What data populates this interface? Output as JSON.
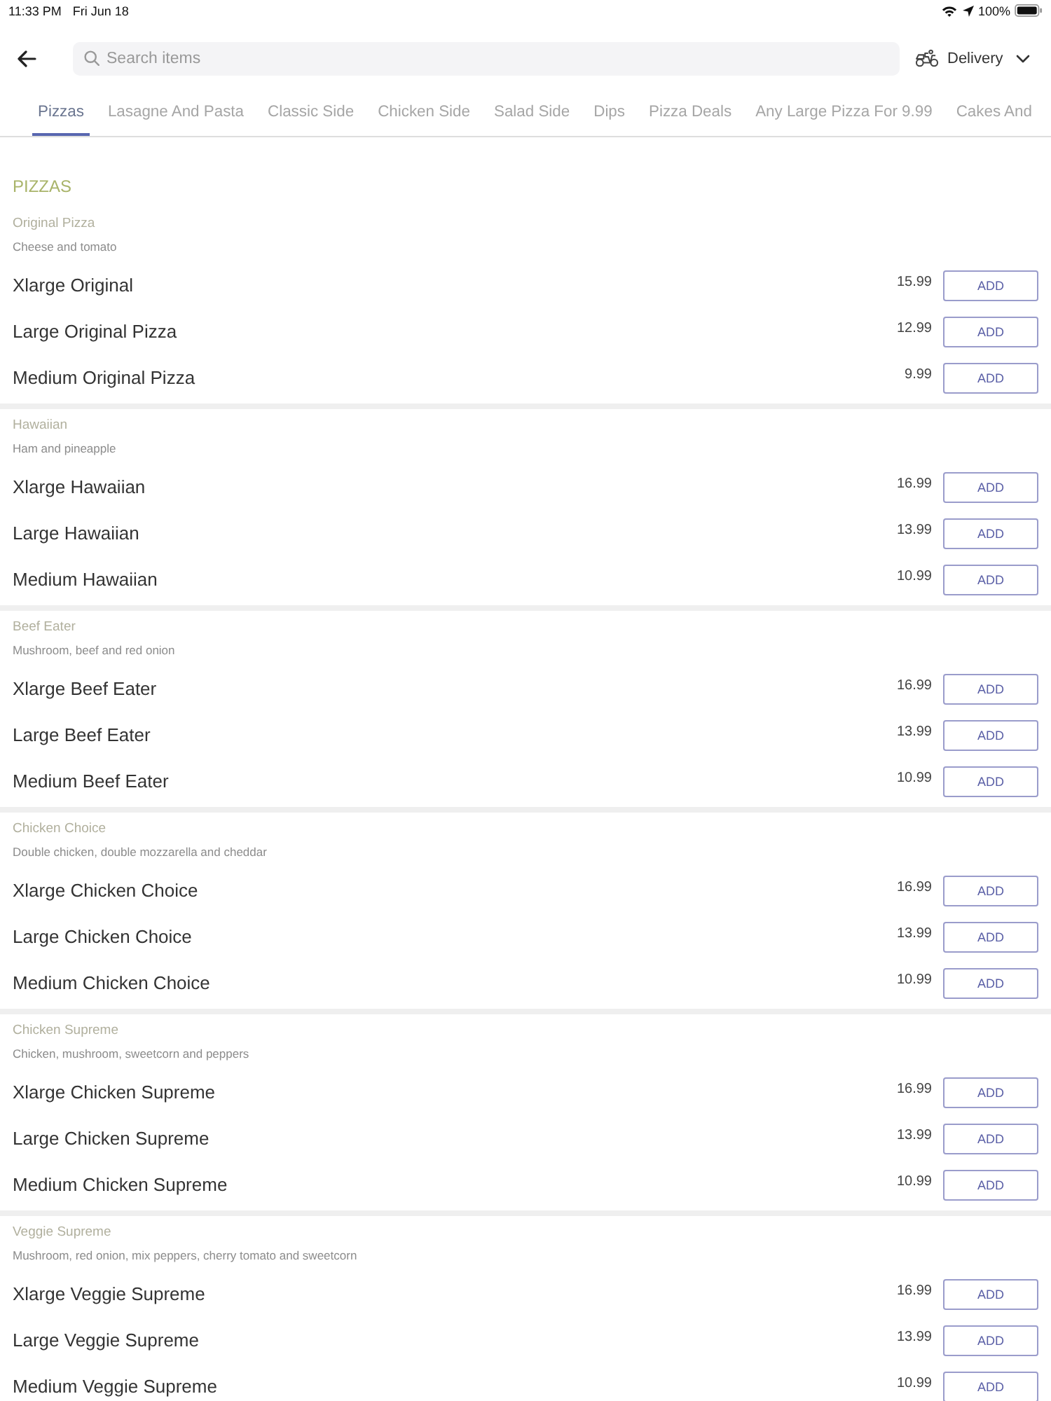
{
  "status_bar": {
    "time": "11:33 PM",
    "date": "Fri Jun 18",
    "battery": "100%"
  },
  "header": {
    "search": {
      "placeholder": "Search items"
    },
    "order_type": "Delivery"
  },
  "tabs": [
    {
      "label": "Pizzas",
      "selected": true
    },
    {
      "label": "Lasagne And Pasta",
      "selected": false
    },
    {
      "label": "Classic Side",
      "selected": false
    },
    {
      "label": "Chicken Side",
      "selected": false
    },
    {
      "label": "Salad Side",
      "selected": false
    },
    {
      "label": "Dips",
      "selected": false
    },
    {
      "label": "Pizza Deals",
      "selected": false
    },
    {
      "label": "Any Large Pizza For 9.99",
      "selected": false
    },
    {
      "label": "Cakes And",
      "selected": false
    }
  ],
  "section": {
    "title": "PIZZAS",
    "groups": [
      {
        "title": "Original Pizza",
        "description": "Cheese and tomato",
        "items": [
          {
            "name": "Xlarge Original",
            "price": "15.99",
            "button": "ADD"
          },
          {
            "name": "Large Original Pizza",
            "price": "12.99",
            "button": "ADD"
          },
          {
            "name": "Medium Original Pizza",
            "price": "9.99",
            "button": "ADD"
          }
        ]
      },
      {
        "title": "Hawaiian",
        "description": "Ham and pineapple",
        "items": [
          {
            "name": "Xlarge Hawaiian",
            "price": "16.99",
            "button": "ADD"
          },
          {
            "name": "Large Hawaiian",
            "price": "13.99",
            "button": "ADD"
          },
          {
            "name": "Medium Hawaiian",
            "price": "10.99",
            "button": "ADD"
          }
        ]
      },
      {
        "title": "Beef Eater",
        "description": "Mushroom, beef and red onion",
        "items": [
          {
            "name": "Xlarge Beef Eater",
            "price": "16.99",
            "button": "ADD"
          },
          {
            "name": "Large Beef Eater",
            "price": "13.99",
            "button": "ADD"
          },
          {
            "name": "Medium Beef Eater",
            "price": "10.99",
            "button": "ADD"
          }
        ]
      },
      {
        "title": "Chicken Choice",
        "description": "Double chicken, double mozzarella and cheddar",
        "items": [
          {
            "name": "Xlarge Chicken Choice",
            "price": "16.99",
            "button": "ADD"
          },
          {
            "name": "Large Chicken Choice",
            "price": "13.99",
            "button": "ADD"
          },
          {
            "name": "Medium Chicken Choice",
            "price": "10.99",
            "button": "ADD"
          }
        ]
      },
      {
        "title": "Chicken Supreme",
        "description": "Chicken, mushroom, sweetcorn and peppers",
        "items": [
          {
            "name": "Xlarge Chicken Supreme",
            "price": "16.99",
            "button": "ADD"
          },
          {
            "name": "Large Chicken Supreme",
            "price": "13.99",
            "button": "ADD"
          },
          {
            "name": "Medium Chicken Supreme",
            "price": "10.99",
            "button": "ADD"
          }
        ]
      },
      {
        "title": "Veggie Supreme",
        "description": "Mushroom, red onion, mix peppers, cherry tomato and sweetcorn",
        "items": [
          {
            "name": "Xlarge Veggie Supreme",
            "price": "16.99",
            "button": "ADD"
          },
          {
            "name": "Large Veggie Supreme",
            "price": "13.99",
            "button": "ADD"
          },
          {
            "name": "Medium Veggie Supreme",
            "price": "10.99",
            "button": "ADD"
          }
        ]
      }
    ]
  }
}
